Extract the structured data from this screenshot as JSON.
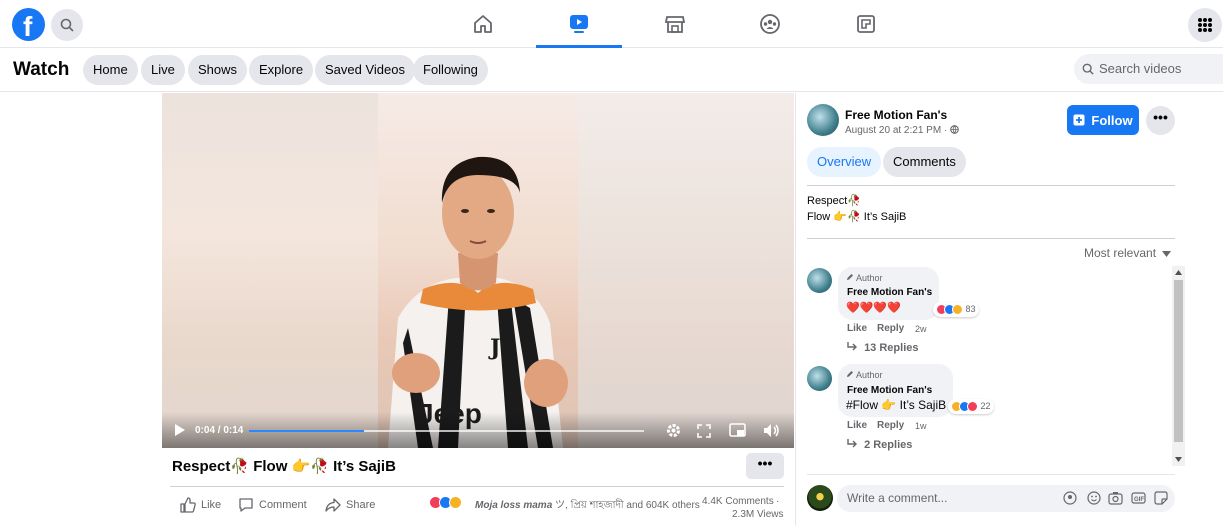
{
  "brand": {
    "logo_letter": "f",
    "accent": "#1877f2"
  },
  "topbar": {
    "icons": [
      "search-icon",
      "home-icon",
      "watch-icon",
      "marketplace-icon",
      "groups-icon",
      "gaming-icon",
      "menu-grid-icon"
    ]
  },
  "watchbar": {
    "title": "Watch",
    "pills": [
      "Home",
      "Live",
      "Shows",
      "Explore",
      "Saved Videos",
      "Following"
    ],
    "search_placeholder": "Search videos"
  },
  "video": {
    "time": "0:04 / 0:14",
    "progress": 0.29,
    "jersey_text": "Jeep"
  },
  "post": {
    "title_a": "Respect",
    "title_b": "Flow",
    "title_c": "It’s SajiB",
    "more": "•••",
    "actions": {
      "like": "Like",
      "comment": "Comment",
      "share": "Share"
    },
    "reactions_text_name": "Moja loss mama",
    "reactions_text_rest": "ツ, প্রিয় শাহজাদী and 604K others",
    "comments_count": "4.4K Comments",
    "views": "2.3M Views"
  },
  "page": {
    "name": "Free Motion Fan's",
    "date": "August 20 at 2:21 PM",
    "date_sep": "·",
    "follow_label": "Follow",
    "more": "•••",
    "tabs": [
      "Overview",
      "Comments"
    ],
    "caption_line1": "Respect",
    "caption_line2_a": "Flow",
    "caption_line2_b": "It’s SajiB",
    "sort_label": "Most relevant"
  },
  "comments": [
    {
      "author_badge": "Author",
      "name": "Free Motion Fan's",
      "text": "❤️❤️❤️❤️",
      "reaction_count": "83",
      "like": "Like",
      "reply": "Reply",
      "age": "2w",
      "replies": "13 Replies"
    },
    {
      "author_badge": "Author",
      "name": "Free Motion Fan's",
      "text_a": "#Flow",
      "text_b": "It’s SajiB",
      "reaction_count": "22",
      "like": "Like",
      "reply": "Reply",
      "age": "1w",
      "replies": "2 Replies"
    }
  ],
  "comment_box": {
    "placeholder": "Write a comment..."
  }
}
